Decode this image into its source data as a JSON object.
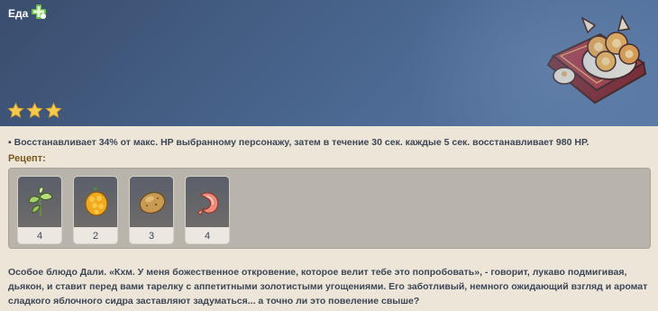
{
  "header": {
    "category_label": "Еда",
    "category_icon": "food-category-icon",
    "stars": 3,
    "dish_icon": "dish-pastry-plate-icon"
  },
  "effect_text": "▪ Восстанавливает 34% от макс. HP выбранному персонажу, затем в течение 30 сек. каждые 5 сек. восстанавливает 980 HP.",
  "recipe": {
    "label": "Рецепт:",
    "ingredients": [
      {
        "icon": "mint-icon",
        "count": "4"
      },
      {
        "icon": "sunsettia-icon",
        "count": "2"
      },
      {
        "icon": "potato-icon",
        "count": "3"
      },
      {
        "icon": "shrimp-meat-icon",
        "count": "4"
      }
    ]
  },
  "description": "Особое блюдо Дали. «Кхм. У меня божественное откровение, которое велит тебе это попробовать», - говорит, лукаво подмигивая, дьякон, и ставит перед вами тарелку с аппетитными золотистыми угощениями. Его заботливый, немного ожидающий взгляд и аромат сладкого яблочного сидра заставляют задуматься... а точно ли это повеление свыше?",
  "colors": {
    "header_bg": "#4a6790",
    "star": "#f5c94c",
    "recipe_label": "#7a5a1e",
    "body_bg": "#ece5d8"
  }
}
